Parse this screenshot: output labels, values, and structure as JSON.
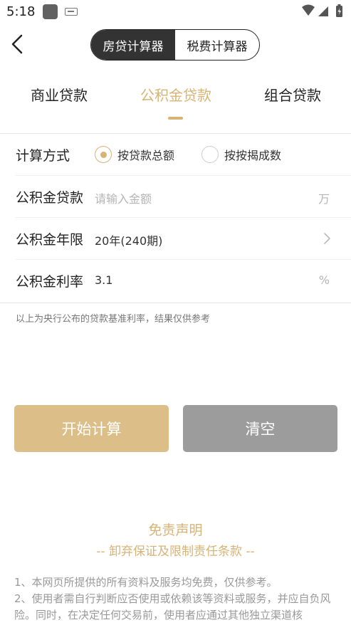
{
  "status_bar": {
    "time": "5:18"
  },
  "header": {
    "segments": [
      "房贷计算器",
      "税费计算器"
    ],
    "active_segment": 0
  },
  "tabs": {
    "items": [
      "商业贷款",
      "公积金贷款",
      "组合贷款"
    ],
    "active": 1
  },
  "form": {
    "method": {
      "label": "计算方式",
      "options": [
        "按贷款总额",
        "按按揭成数"
      ],
      "selected": 0
    },
    "amount": {
      "label": "公积金贷款",
      "placeholder": "请输入金额",
      "unit": "万"
    },
    "term": {
      "label": "公积金年限",
      "value": "20年(240期)"
    },
    "rate": {
      "label": "公积金利率",
      "value": "3.1",
      "unit": "%"
    }
  },
  "note": "以上为央行公布的贷款基准利率，结果仅供参考",
  "buttons": {
    "start": "开始计算",
    "clear": "清空"
  },
  "disclaimer": {
    "title": "免责声明",
    "subtitle": "-- 卸弃保证及限制责任条款 --",
    "line1": "1、本网页所提供的所有资料及服务均免费，仅供参考。",
    "line2": "2、使用者需自行判断应否使用或依赖该等资料或服务，并应自负风险。同时，在决定任何交易前，使用者应通过其他独立渠道核"
  },
  "colors": {
    "accent": "#d8b376",
    "start_button": "#dcbe89",
    "clear_button": "#9c9c9c"
  }
}
